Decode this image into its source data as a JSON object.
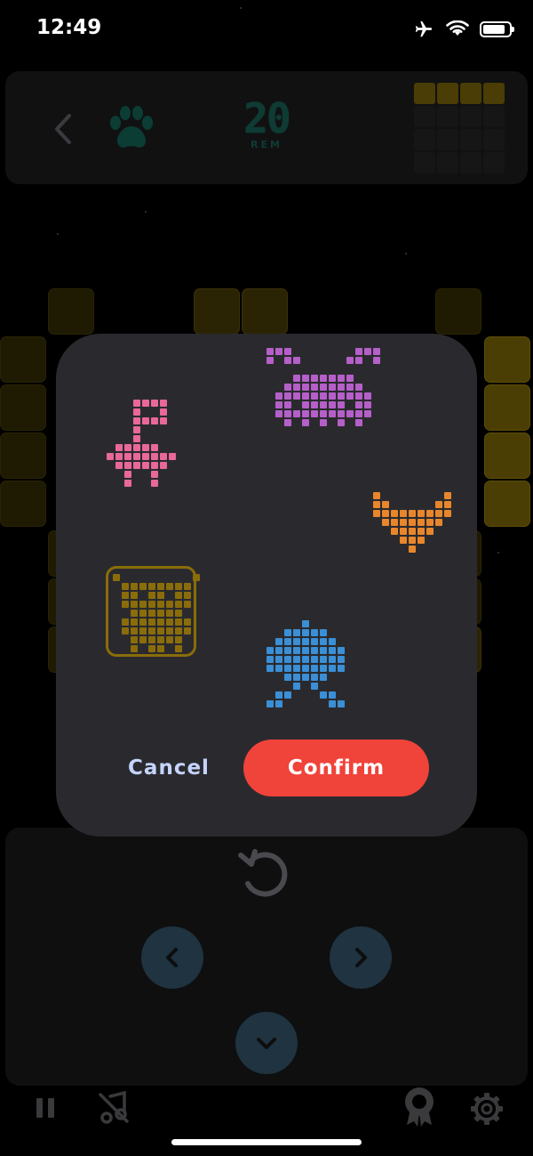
{
  "status_bar": {
    "time": "12:49",
    "icons": [
      "airplane-icon",
      "wifi-icon",
      "battery-icon"
    ],
    "battery_level": 0.85
  },
  "header": {
    "back_icon": "chevron-left-icon",
    "theme_icon": "paw-icon",
    "remaining_count": "20",
    "remaining_label": "REM"
  },
  "modal": {
    "pixel_art_options": [
      {
        "name": "flamingo",
        "color": "#e8689a"
      },
      {
        "name": "crab",
        "color": "#b55fc9"
      },
      {
        "name": "fox",
        "color": "#e8862c"
      },
      {
        "name": "owl",
        "color": "#8a6d0a"
      },
      {
        "name": "octopus",
        "color": "#3a8fd6"
      }
    ],
    "cancel_label": "Cancel",
    "confirm_label": "Confirm"
  },
  "controls": {
    "rotate_icon": "rotate-ccw-icon",
    "left_icon": "chevron-left-icon",
    "right_icon": "chevron-right-icon",
    "down_icon": "chevron-down-icon"
  },
  "bottom_bar": {
    "icons": [
      "pause-icon",
      "music-off-icon",
      "award-icon",
      "gear-icon"
    ]
  },
  "colors": {
    "accent_red": "#f0433a",
    "cancel_text": "#c5d4ff",
    "modal_bg": "#2a2a2e",
    "counter_teal": "#0e3b34"
  }
}
